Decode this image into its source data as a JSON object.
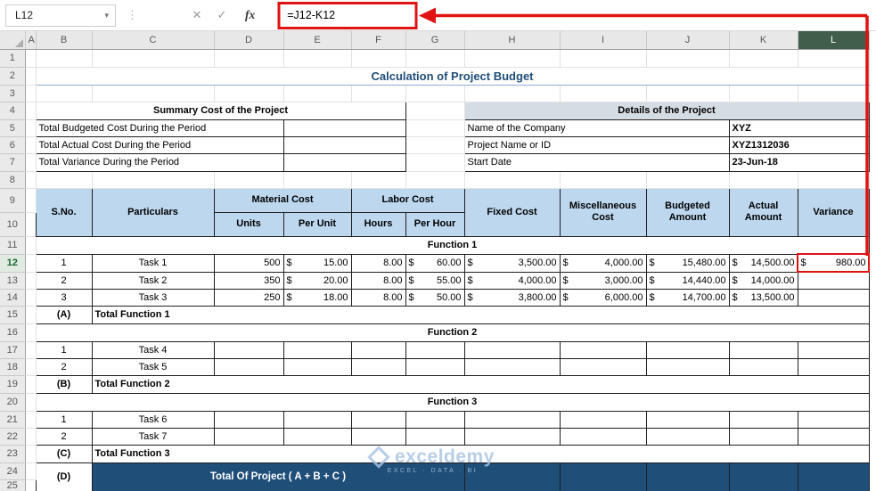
{
  "formula_bar": {
    "name_box": "L12",
    "formula": "=J12-K12"
  },
  "icons": {
    "name_box_dropdown": "▾",
    "grip_dots": "⋮",
    "cancel": "✕",
    "enter": "✓",
    "fx": "fx"
  },
  "grid": {
    "col_letters": [
      "A",
      "B",
      "C",
      "D",
      "E",
      "F",
      "G",
      "H",
      "I",
      "J",
      "K",
      "L"
    ],
    "row_numbers": [
      "1",
      "2",
      "3",
      "4",
      "5",
      "6",
      "7",
      "8",
      "9",
      "10",
      "11",
      "12",
      "13",
      "14",
      "15",
      "16",
      "17",
      "18",
      "19",
      "20",
      "21",
      "22",
      "23",
      "24",
      "25"
    ]
  },
  "title": "Calculation of Project Budget",
  "summary_table": {
    "header": "Summary Cost of the Project",
    "rows": [
      "Total Budgeted Cost During the Period",
      "Total Actual Cost During the Period",
      "Total Variance During the Period"
    ]
  },
  "details_table": {
    "header": "Details of the Project",
    "rows": [
      {
        "label": "Name of the Company",
        "value": "XYZ"
      },
      {
        "label": "Project Name or ID",
        "value": "XYZ1312036"
      },
      {
        "label": "Start Date",
        "value": "23-Jun-18"
      }
    ]
  },
  "budget_table": {
    "cur": "$",
    "headers": {
      "sno": "S.No.",
      "particulars": "Particulars",
      "material": "Material Cost",
      "units": "Units",
      "per_unit": "Per Unit",
      "labor": "Labor Cost",
      "hours": "Hours",
      "per_hour": "Per Hour",
      "fixed": "Fixed Cost",
      "misc": "Miscellaneous Cost",
      "budgeted": "Budgeted Amount",
      "actual": "Actual Amount",
      "variance": "Variance"
    },
    "function1": {
      "title": "Function 1",
      "total_code": "(A)",
      "total_label": "Total Function 1",
      "rows": [
        {
          "sno": "1",
          "task": "Task 1",
          "units": "500",
          "per_unit": "15.00",
          "hours": "8.00",
          "per_hour": "60.00",
          "fixed": "3,500.00",
          "misc": "4,000.00",
          "budgeted": "15,480.00",
          "actual": "14,500.00",
          "variance": "980.00"
        },
        {
          "sno": "2",
          "task": "Task 2",
          "units": "350",
          "per_unit": "20.00",
          "hours": "8.00",
          "per_hour": "55.00",
          "fixed": "4,000.00",
          "misc": "3,000.00",
          "budgeted": "14,440.00",
          "actual": "14,000.00"
        },
        {
          "sno": "3",
          "task": "Task 3",
          "units": "250",
          "per_unit": "18.00",
          "hours": "8.00",
          "per_hour": "50.00",
          "fixed": "3,800.00",
          "misc": "6,000.00",
          "budgeted": "14,700.00",
          "actual": "13,500.00"
        }
      ]
    },
    "function2": {
      "title": "Function 2",
      "total_code": "(B)",
      "total_label": "Total Function 2",
      "rows": [
        {
          "sno": "1",
          "task": "Task 4"
        },
        {
          "sno": "2",
          "task": "Task 5"
        }
      ]
    },
    "function3": {
      "title": "Function 3",
      "total_code": "(C)",
      "total_label": "Total Function 3",
      "rows": [
        {
          "sno": "1",
          "task": "Task 6"
        },
        {
          "sno": "2",
          "task": "Task 7"
        }
      ]
    },
    "grand_total": {
      "code": "(D)",
      "label": "Total Of Project ( A + B + C )"
    }
  },
  "watermark": {
    "name": "exceldemy",
    "tagline": "EXCEL · DATA · BI"
  },
  "colors": {
    "annotation_red": "#E01313",
    "table_header_fill": "#BDD7EE",
    "details_header_fill": "#D6DCE4",
    "banner_fill": "#1F4E79",
    "title_text": "#1F4E79",
    "selected_column_fill": "#415D4B"
  }
}
